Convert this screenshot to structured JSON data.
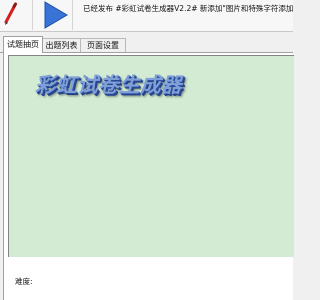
{
  "toolbar": {
    "pencil_icon": "pencil-icon",
    "play_icon": "play-icon",
    "notice_text": "已经发布 #彩虹试卷生成器V2.2# 新添加\"图片和特殊字符添加\"功能。"
  },
  "tabs": [
    {
      "label": "试题抽页",
      "active": true
    },
    {
      "label": "出题列表",
      "active": false
    },
    {
      "label": "页面设置",
      "active": false
    }
  ],
  "editor": {
    "logo_text": "彩虹试卷生成器",
    "background_color": "#d2ebd2"
  },
  "footer": {
    "difficulty_label": "难度:"
  },
  "colors": {
    "play_blue": "#3a73d6",
    "pencil_red": "#d32020",
    "logo_blue": "#7f9fd9"
  }
}
